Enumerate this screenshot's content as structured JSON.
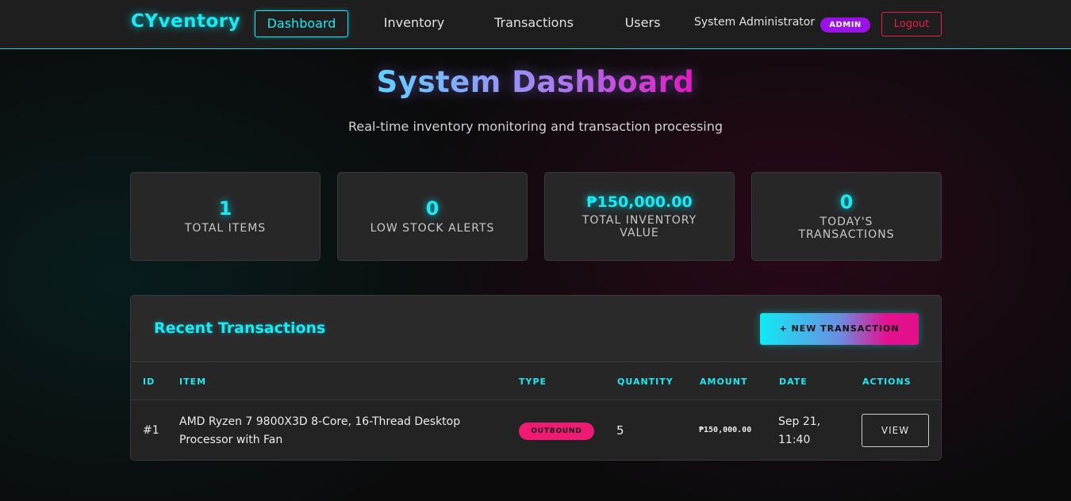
{
  "nav": {
    "brand": "CYventory",
    "links": [
      "Dashboard",
      "Inventory",
      "Transactions",
      "Users"
    ],
    "active": "Dashboard",
    "user_name": "System Administrator",
    "role_badge": "ADMIN",
    "logout": "Logout"
  },
  "header": {
    "title": "System Dashboard",
    "subtitle": "Real-time inventory monitoring and transaction processing"
  },
  "stats": [
    {
      "value": "1",
      "label": "TOTAL ITEMS"
    },
    {
      "value": "0",
      "label": "LOW STOCK ALERTS"
    },
    {
      "value": "₱150,000.00",
      "label": "TOTAL INVENTORY VALUE"
    },
    {
      "value": "0",
      "label": "TODAY'S TRANSACTIONS"
    }
  ],
  "transactions": {
    "title": "Recent Transactions",
    "new_button": "+ NEW TRANSACTION",
    "columns": [
      "ID",
      "ITEM",
      "TYPE",
      "QUANTITY",
      "AMOUNT",
      "DATE",
      "ACTIONS"
    ],
    "rows": [
      {
        "id": "#1",
        "item": "AMD Ryzen 7 9800X3D 8-Core, 16-Thread Desktop Processor with Fan",
        "type": "OUTBOUND",
        "quantity": "5",
        "amount": "₱150,000.00",
        "date": "Sep 21, 11:40",
        "action": "VIEW"
      }
    ]
  },
  "colors": {
    "accent": "#1ee8f2",
    "admin_badge": "#9b12e6",
    "outbound_badge": "#ef1a74",
    "logout": "#e6204a"
  }
}
